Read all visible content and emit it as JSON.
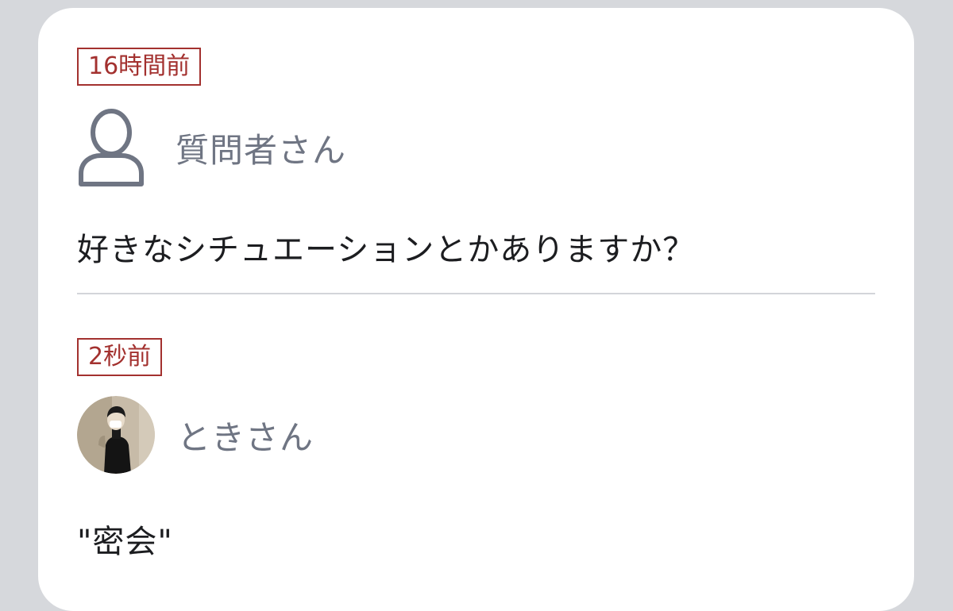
{
  "question": {
    "timestamp": "16時間前",
    "author": "質問者さん",
    "text": "好きなシチュエーションとかありますか？"
  },
  "answer": {
    "timestamp": "2秒前",
    "author": "ときさん",
    "text": "\"密会\""
  },
  "colors": {
    "accent": "#a3312f",
    "username": "#6f7583",
    "text": "#1c1d20",
    "background": "#d6d8dc",
    "card": "#ffffff",
    "divider": "#d3d5d9"
  },
  "icons": {
    "questioner": "person-outline-icon",
    "answerer": "avatar-photo"
  }
}
